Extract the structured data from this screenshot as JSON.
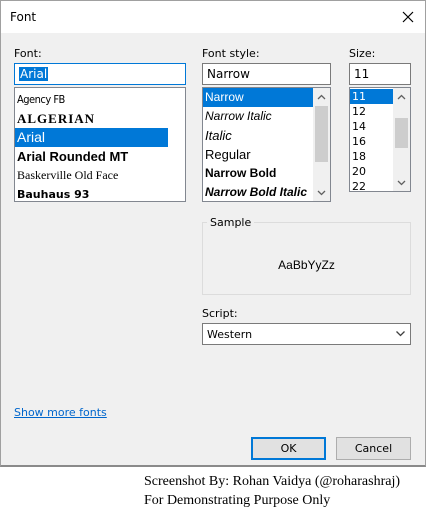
{
  "window": {
    "title": "Font"
  },
  "font": {
    "label": "Font:",
    "value": "Arial",
    "items": [
      "Agency FB",
      "ALGERIAN",
      "Arial",
      "Arial Rounded MT",
      "Baskerville Old Face",
      "Bauhaus 93"
    ],
    "selected": "Arial"
  },
  "style": {
    "label": "Font style:",
    "value": "Narrow",
    "items": [
      "Narrow",
      "Narrow Italic",
      "Italic",
      "Regular",
      "Narrow Bold",
      "Narrow Bold Italic"
    ],
    "selected": "Narrow"
  },
  "size": {
    "label": "Size:",
    "value": "11",
    "items": [
      "11",
      "12",
      "14",
      "16",
      "18",
      "20",
      "22"
    ],
    "selected": "11"
  },
  "sample": {
    "label": "Sample",
    "text": "AaBbYyZz"
  },
  "script": {
    "label": "Script:",
    "value": "Western"
  },
  "links": {
    "show_more": "Show more fonts"
  },
  "buttons": {
    "ok": "OK",
    "cancel": "Cancel"
  },
  "caption": {
    "line1": "Screenshot By: Rohan Vaidya (@roharashraj)",
    "line2": "For Demonstrating Purpose Only"
  },
  "icons": {
    "close": "close-icon",
    "up": "chevron-up-icon",
    "down": "chevron-down-icon"
  },
  "colors": {
    "accent": "#0078d7",
    "link": "#0066cc",
    "dialog_bg": "#f0f0f0"
  }
}
